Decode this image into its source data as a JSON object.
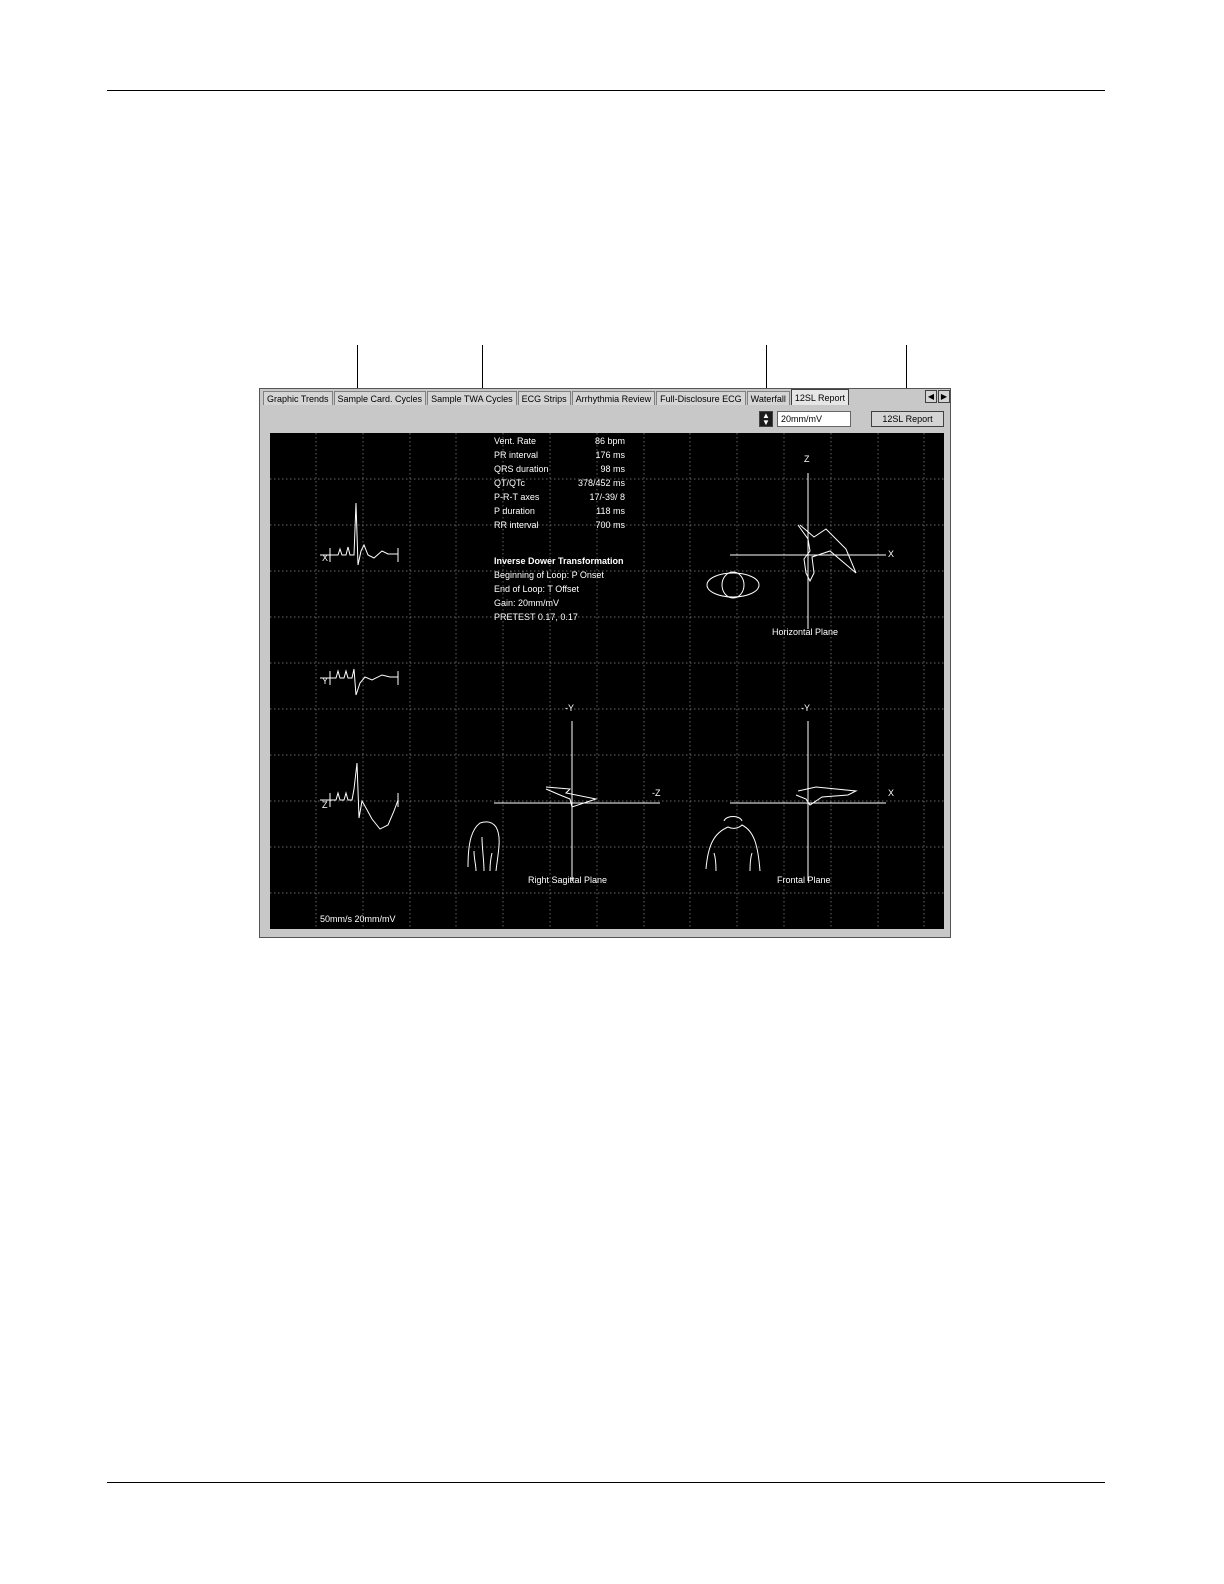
{
  "tabs": [
    "Graphic Trends",
    "Sample Card. Cycles",
    "Sample TWA Cycles",
    "ECG Strips",
    "Arrhythmia Review",
    "Full-Disclosure ECG",
    "Waterfall",
    "12SL Report"
  ],
  "active_tab": "12SL Report",
  "toolbar": {
    "scale_value": "20mm/mV",
    "report_button": "12SL Report"
  },
  "leads": {
    "x": "X",
    "y": "Y",
    "z": "Z"
  },
  "measurements": [
    {
      "label": "Vent. Rate",
      "value": "86 bpm"
    },
    {
      "label": "PR interval",
      "value": "176 ms"
    },
    {
      "label": "QRS duration",
      "value": "98 ms"
    },
    {
      "label": "QT/QTc",
      "value": "378/452 ms"
    },
    {
      "label": "P-R-T axes",
      "value": "17/-39/ 8"
    },
    {
      "label": "P duration",
      "value": "118 ms"
    },
    {
      "label": "RR interval",
      "value": "700 ms"
    }
  ],
  "transformation": {
    "title": "Inverse Dower Transformation",
    "lines": [
      "Beginning of Loop: P Onset",
      "End of Loop: T Offset",
      "Gain: 20mm/mV",
      "PRETEST 0.17,   0.17"
    ]
  },
  "planes": {
    "horizontal": {
      "label": "Horizontal Plane",
      "axis_v": "Z",
      "axis_h": "X"
    },
    "sagittal": {
      "label": "Right Sagittal Plane",
      "axis_v": "-Y",
      "axis_h": "-Z"
    },
    "frontal": {
      "label": "Frontal Plane",
      "axis_v": "-Y",
      "axis_h": "X"
    }
  },
  "footer": "50mm/s  20mm/mV",
  "colors": {
    "panel_bg": "#000000",
    "grid": "#8a8a8a",
    "trace": "#ffffff"
  }
}
